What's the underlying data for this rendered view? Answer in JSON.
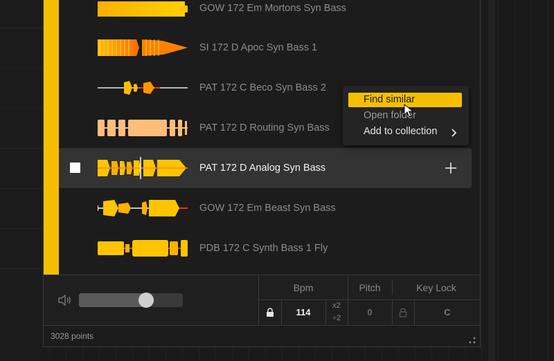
{
  "library": {
    "samples": [
      {
        "name": "GOW 172 Em Mortons Syn Bass",
        "waveform": "dense-block",
        "selected": false
      },
      {
        "name": "SI 172 D Apoc Syn Bass 1",
        "waveform": "dense-taper",
        "selected": false
      },
      {
        "name": "PAT 172 C Beco Syn Bass 2",
        "waveform": "sparse-line",
        "selected": false
      },
      {
        "name": "PAT 172 D Routing Syn Bass",
        "waveform": "pulses",
        "selected": false
      },
      {
        "name": "PAT 172 D Analog Syn Bass",
        "waveform": "bursts",
        "selected": true
      },
      {
        "name": "GOW 172 Em Beast Syn Bass",
        "waveform": "segments",
        "selected": false
      },
      {
        "name": "PDB 172 C Synth Bass 1 Fly",
        "waveform": "bars",
        "selected": false
      }
    ]
  },
  "context_menu": {
    "items": [
      {
        "label": "Find similar",
        "state": "highlighted"
      },
      {
        "label": "Open folder",
        "state": "normal"
      },
      {
        "label": "Add to collection",
        "state": "normal",
        "submenu": true
      }
    ]
  },
  "controls": {
    "volume_level": 0.67,
    "bpm_label": "Bpm",
    "bpm_value": "114",
    "double_label": "x2",
    "half_label": "÷2",
    "pitch_label": "Pitch",
    "pitch_value": "0",
    "keylock_label": "Key Lock",
    "key_value": "C"
  },
  "footer": {
    "points": "3028 points"
  },
  "colors": {
    "accent": "#f5bf00",
    "wave_orange": "#ff8a00",
    "wave_yellow": "#ffc400",
    "wave_red": "#ff3300",
    "wave_peach": "#ffbd7a"
  },
  "icons": [
    "speaker-icon",
    "lock-icon",
    "plus-icon",
    "chevron-right-icon",
    "grip-icon",
    "cursor-icon"
  ]
}
